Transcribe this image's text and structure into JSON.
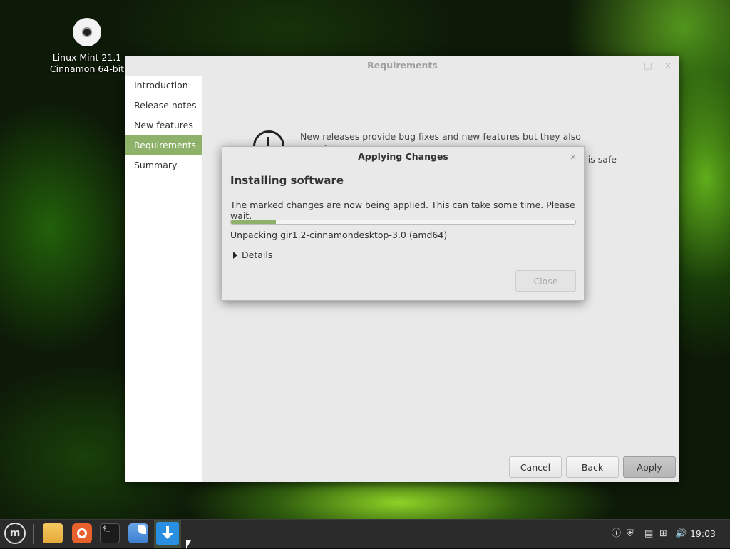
{
  "desktop": {
    "icon_label_line1": "Linux Mint 21.1",
    "icon_label_line2": "Cinnamon 64-bit",
    "icon": "disc-icon"
  },
  "window": {
    "title": "Requirements",
    "controls": [
      "–",
      "□",
      "×"
    ],
    "sidebar": [
      {
        "label": "Introduction",
        "active": false
      },
      {
        "label": "Release notes",
        "active": false
      },
      {
        "label": "New features",
        "active": false
      },
      {
        "label": "Requirements",
        "active": true
      },
      {
        "label": "Summary",
        "active": false
      }
    ],
    "content": {
      "line1": "New releases provide bug fixes and new features but they also sometimes",
      "line2_partial": "a is safe"
    },
    "buttons": {
      "cancel": "Cancel",
      "back": "Back",
      "apply": "Apply"
    },
    "accent_color": "#8fb26b"
  },
  "dialog": {
    "title": "Applying Changes",
    "close_glyph": "×",
    "heading": "Installing software",
    "message": "The marked changes are now being applied. This can take some time. Please wait.",
    "progress_fraction": 0.13,
    "status": "Unpacking gir1.2-cinnamondesktop-3.0 (amd64)",
    "details_label": "Details",
    "close_button": "Close"
  },
  "taskbar": {
    "apps": [
      "menu-icon",
      "folder-icon",
      "firefox-icon",
      "terminal-icon",
      "files-icon",
      "update-manager-icon"
    ],
    "terminal_glyph": "$_",
    "tray": [
      "info-icon",
      "shield-icon",
      "clipboard-icon",
      "network-icon",
      "volume-icon"
    ],
    "clock": "19:03"
  }
}
